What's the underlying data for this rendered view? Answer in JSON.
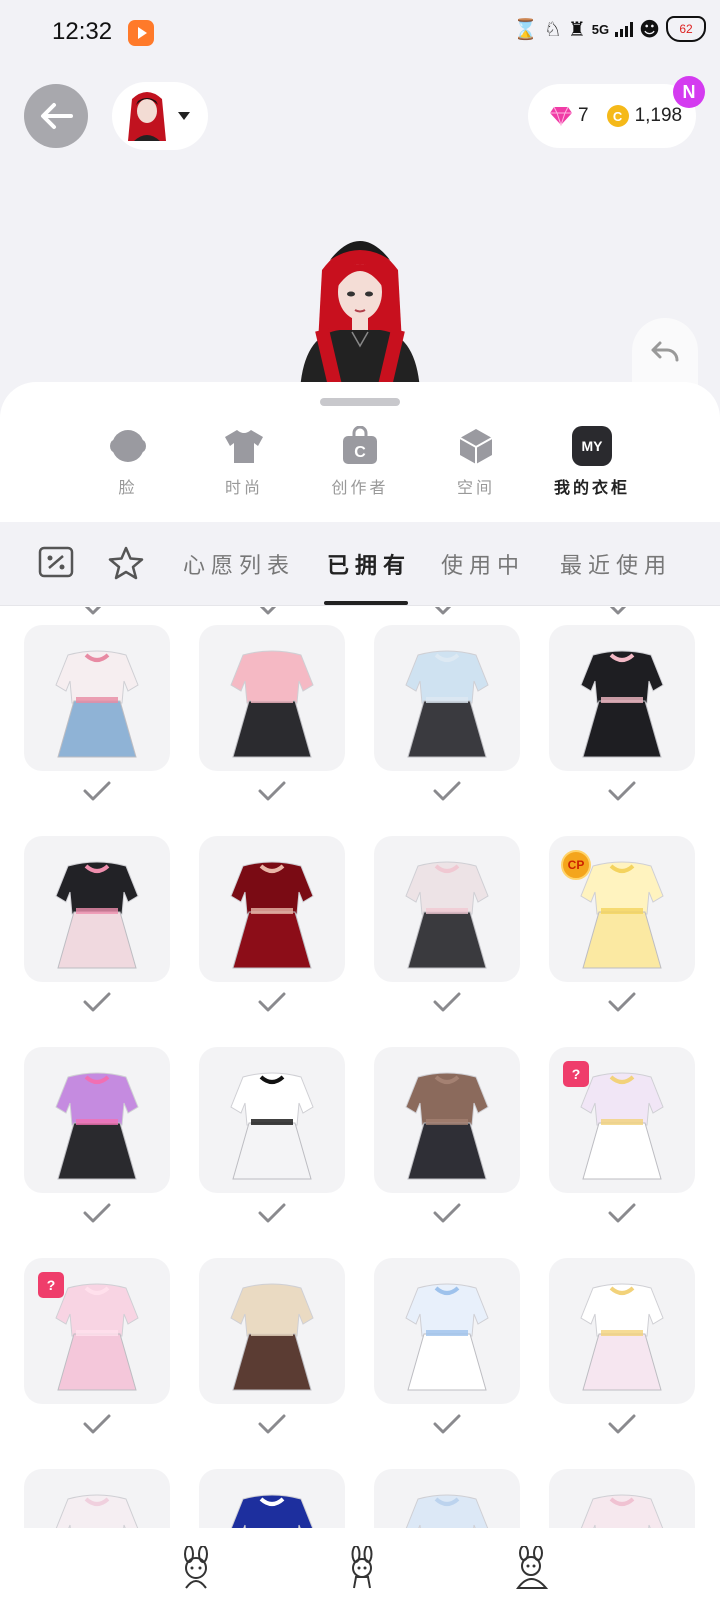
{
  "status_bar": {
    "time": "12:32",
    "network": "5G",
    "battery": "62"
  },
  "currency": {
    "gems": "7",
    "coins": "1,198",
    "coin_symbol": "C",
    "notification_badge": "N"
  },
  "categories": [
    {
      "label": "脸",
      "icon": "face-icon"
    },
    {
      "label": "时尚",
      "icon": "tshirt-icon"
    },
    {
      "label": "创作者",
      "icon": "creator-bag-icon",
      "icon_text": "C"
    },
    {
      "label": "空间",
      "icon": "space-cube-icon"
    },
    {
      "label": "我的衣柜",
      "icon": "my-closet-icon",
      "icon_text": "MY",
      "active": true
    }
  ],
  "tabs": [
    {
      "label": "心愿列表"
    },
    {
      "label": "已拥有",
      "active": true
    },
    {
      "label": "使用中"
    },
    {
      "label": "最近使用"
    }
  ],
  "badges": {
    "cp": "CP",
    "mystery": "?"
  },
  "outfits": [
    {
      "name": "white-crop-top-denim-skirt",
      "owned": true
    },
    {
      "name": "pink-halter-black-jeans",
      "owned": true
    },
    {
      "name": "blue-sweater-plaid-skirt",
      "owned": true
    },
    {
      "name": "black-lace-dress",
      "owned": true
    },
    {
      "name": "black-pink-lolita-dress",
      "owned": true
    },
    {
      "name": "red-velvet-halter-dress",
      "owned": true
    },
    {
      "name": "white-crop-jacket-flare-jeans",
      "owned": true
    },
    {
      "name": "yellow-tiered-dress",
      "owned": true,
      "badge": "cp"
    },
    {
      "name": "purple-gothic-outfit",
      "owned": true
    },
    {
      "name": "white-bow-dress",
      "owned": true
    },
    {
      "name": "brown-heart-dress",
      "owned": true
    },
    {
      "name": "white-prince-suit",
      "owned": true,
      "badge": "mystery"
    },
    {
      "name": "pink-princess-gown",
      "owned": true,
      "badge": "mystery"
    },
    {
      "name": "cream-fur-sequin-dress",
      "owned": true
    },
    {
      "name": "blue-white-angel-suit",
      "owned": true
    },
    {
      "name": "white-prince-shorts-suit",
      "owned": true
    }
  ],
  "colors": {
    "accent": "#d43bf0",
    "active_text": "#222222",
    "inactive_text": "#999999",
    "card_bg": "#f3f3f5"
  }
}
